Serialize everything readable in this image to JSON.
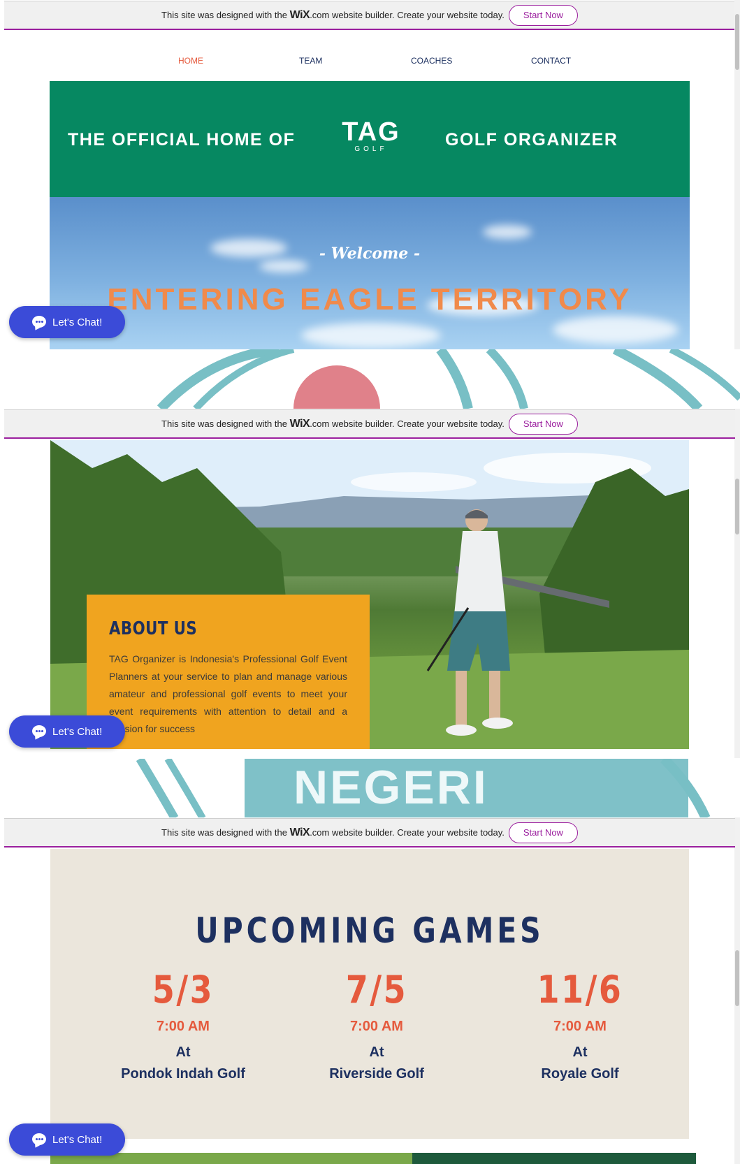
{
  "wix_bar": {
    "text_before": "This site was designed with the",
    "logo": "WiX",
    "text_after": ".com website builder. Create your website today.",
    "button": "Start Now"
  },
  "nav": {
    "items": [
      {
        "label": "HOME",
        "active": true
      },
      {
        "label": "TEAM",
        "active": false
      },
      {
        "label": "COACHES",
        "active": false
      },
      {
        "label": "CONTACT",
        "active": false
      }
    ]
  },
  "banner": {
    "left_text": "THE OFFICIAL HOME OF",
    "logo_text": "TAG",
    "logo_sub": "GOLF",
    "right_text": "GOLF ORGANIZER"
  },
  "hero": {
    "welcome": "- Welcome -",
    "headline": "ENTERING EAGLE TERRITORY"
  },
  "chat": {
    "label": "Let's Chat!"
  },
  "peek_strip": {
    "text": "NEGERI"
  },
  "about": {
    "title": "ABOUT US",
    "body": "TAG Organizer is Indonesia's Professional Golf Event Planners at your service to plan and manage various amateur and professional golf events to meet your event requirements with attention to detail and a passion for success"
  },
  "games": {
    "title": "UPCOMING GAMES",
    "items": [
      {
        "date": "5/3",
        "time": "7:00 AM",
        "at": "At",
        "venue": "Pondok Indah Golf"
      },
      {
        "date": "7/5",
        "time": "7:00 AM",
        "at": "At",
        "venue": "Riverside Golf"
      },
      {
        "date": "11/6",
        "time": "7:00 AM",
        "at": "At",
        "venue": "Royale Golf"
      }
    ]
  },
  "colors": {
    "wix_accent": "#9b1f9e",
    "nav_active": "#e55a3d",
    "nav_text": "#1d3060",
    "banner_green": "#068861",
    "headline_orange": "#f08a4b",
    "about_box": "#f0a41f",
    "games_bg": "#ebe6dc",
    "chat_blue": "#3b4bd8"
  }
}
